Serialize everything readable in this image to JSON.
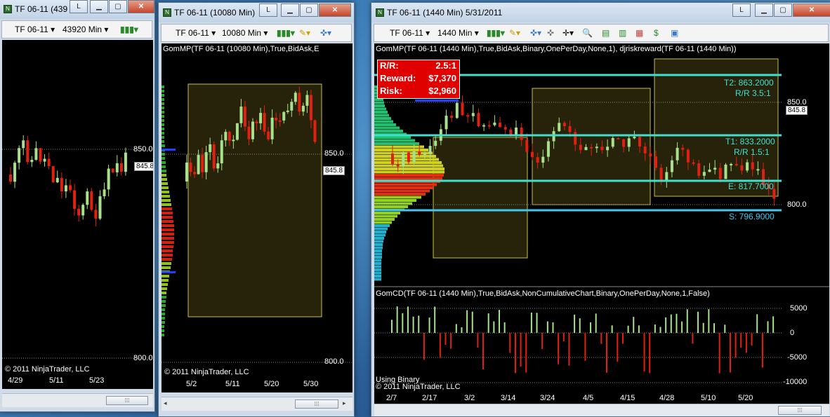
{
  "win1": {
    "title": "TF 06-11 (439",
    "layout_btn": "L",
    "toolbar": {
      "instrument": "TF 06-11",
      "period": "43920 Min"
    },
    "price_labels": [
      "850.0",
      "800.0"
    ],
    "last_price": "845.8",
    "copyright": "© 2011 NinjaTrader, LLC",
    "x_labels": [
      "4/29",
      "5/11",
      "5/23"
    ]
  },
  "win2": {
    "title": "TF 06-11 (10080 Min)",
    "layout_btn": "L",
    "toolbar": {
      "instrument": "TF 06-11",
      "period": "10080 Min"
    },
    "indicator_label": "GomMP(TF 06-11 (10080 Min),True,BidAsk,E",
    "price_labels": [
      "850.0",
      "800.0"
    ],
    "last_price": "845.8",
    "copyright": "© 2011 NinjaTrader, LLC",
    "x_labels": [
      "5/2",
      "5/11",
      "5/20",
      "5/30"
    ]
  },
  "win3": {
    "title": "TF 06-11 (1440 Min)  5/31/2011",
    "layout_btn": "L",
    "toolbar": {
      "instrument": "TF 06-11",
      "period": "1440 Min"
    },
    "indicator_label": "GomMP(TF 06-11 (1440 Min),True,BidAsk,Binary,OnePerDay,None,1), djriskreward(TF 06-11 (1440 Min))",
    "rr_box": [
      {
        "k": "R/R:",
        "v": "2.5:1"
      },
      {
        "k": "Reward:",
        "v": "$7,370"
      },
      {
        "k": "Risk:",
        "v": "$2,960"
      }
    ],
    "levels": {
      "t2": "T2: 863.2000",
      "rr2": "R/R 3.5:1",
      "t1": "T1: 833.2000",
      "rr1": "R/R 1.5:1",
      "entry": "E: 817.7000",
      "stop": "S: 796.9000"
    },
    "price_labels": [
      "850.0",
      "800.0"
    ],
    "last_price": "845.8",
    "cd_label": "GomCD(TF 06-11 (1440 Min),True,BidAsk,NonCumulativeChart,Binary,OnePerDay,None,1,False)",
    "cd_axis": [
      "5000",
      "0",
      "-5000",
      "-10000"
    ],
    "using": "Using Binary",
    "copyright": "© 2011 NinjaTrader, LLC",
    "x_labels": [
      "2/7",
      "2/17",
      "3/2",
      "3/14",
      "3/24",
      "4/5",
      "4/15",
      "4/28",
      "5/10",
      "5/20"
    ]
  },
  "colors": {
    "up": "#a8e08c",
    "down": "#e02010",
    "level": "#40e0d0",
    "box": "#c8c040",
    "rr_bg": "#e00000"
  }
}
